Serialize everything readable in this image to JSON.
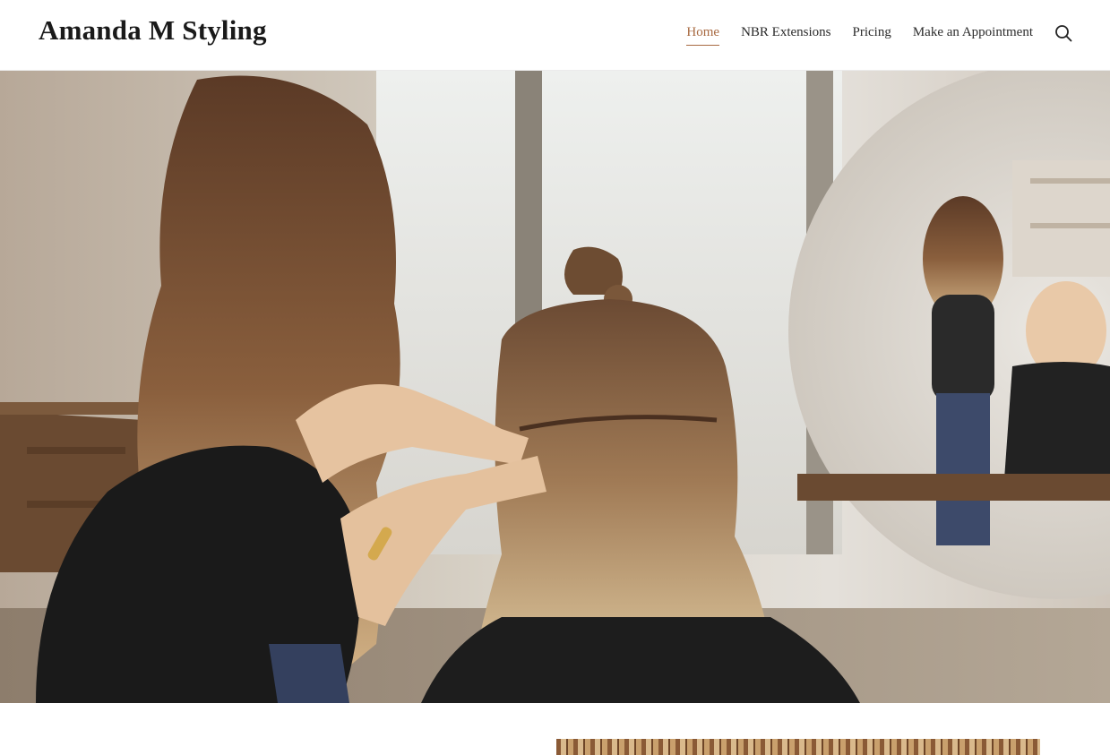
{
  "header": {
    "site_title": "Amanda M Styling",
    "nav": [
      {
        "label": "Home",
        "active": true
      },
      {
        "label": "NBR Extensions",
        "active": false
      },
      {
        "label": "Pricing",
        "active": false
      },
      {
        "label": "Make an Appointment",
        "active": false
      }
    ],
    "search_icon": "search-icon"
  },
  "hero": {
    "scroll_icon": "chevron-down-icon"
  },
  "colors": {
    "accent": "#a86a42",
    "text": "#1a1a1a"
  }
}
